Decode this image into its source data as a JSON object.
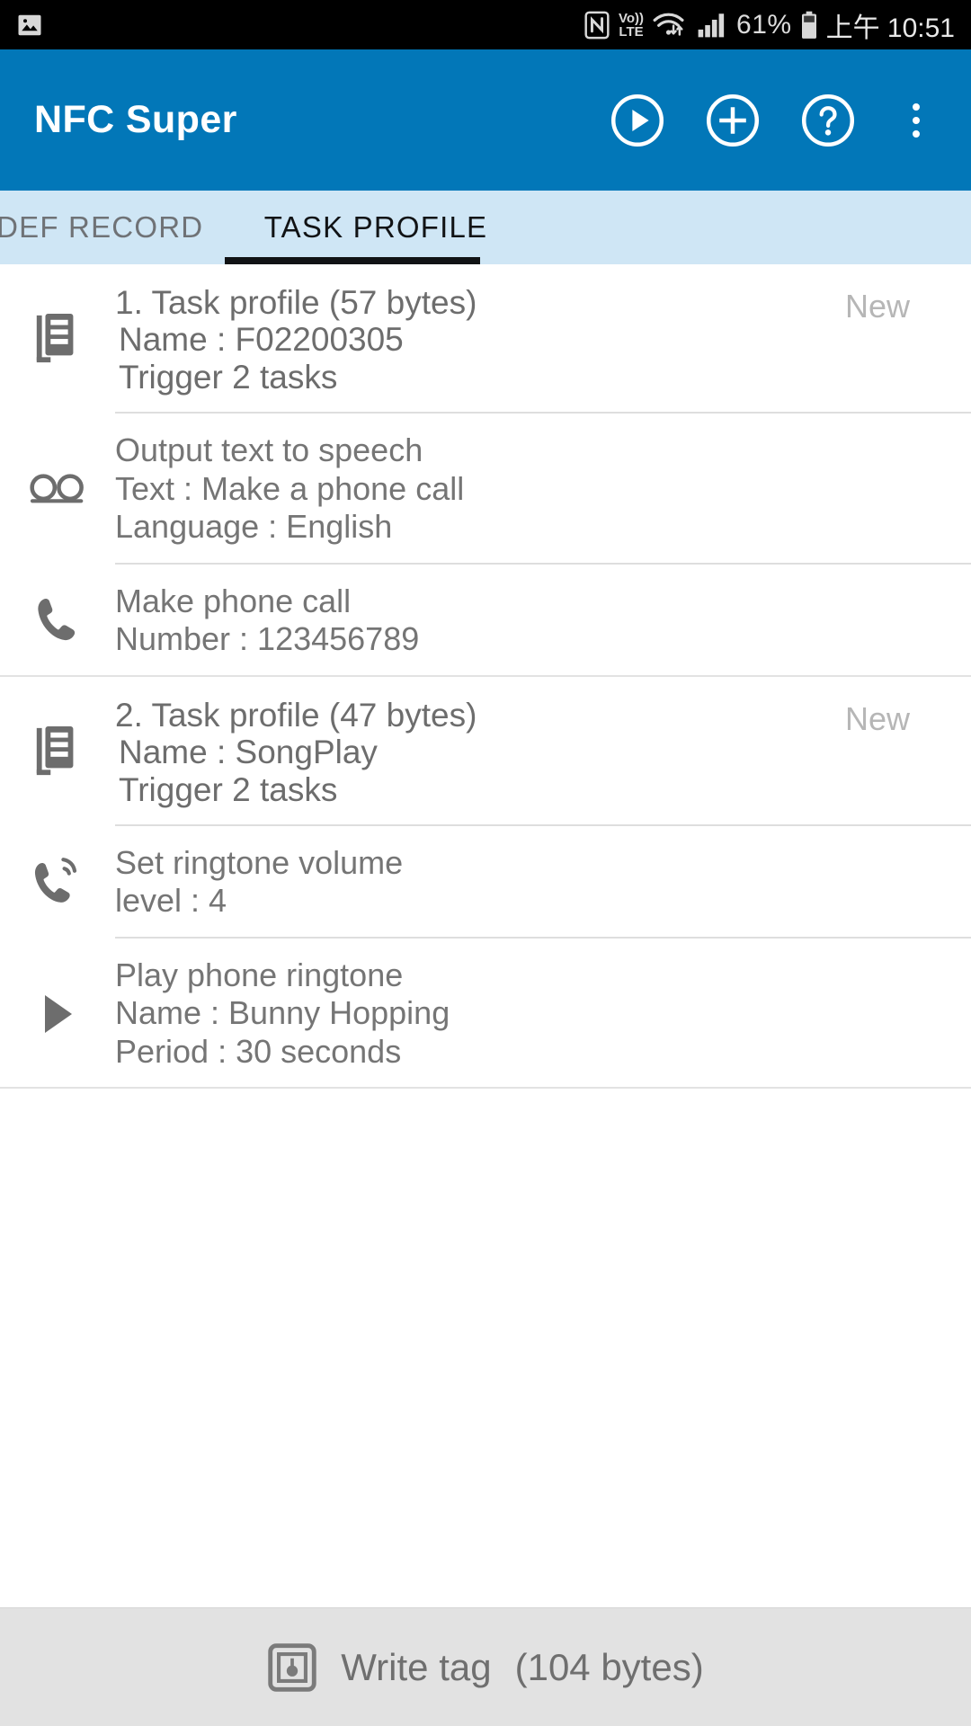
{
  "status_bar": {
    "left_icons": [
      "image-icon"
    ],
    "right_icons": [
      "nfc-icon",
      "volte-icon",
      "wifi-icon",
      "signal-icon",
      "battery-icon"
    ],
    "volte_top": "Vo))",
    "volte_bottom": "LTE",
    "battery_percent": "61%",
    "time": "上午 10:51"
  },
  "app_bar": {
    "title": "NFC Super",
    "actions": [
      {
        "name": "play-circle-icon",
        "label": "Run"
      },
      {
        "name": "plus-circle-icon",
        "label": "Add"
      },
      {
        "name": "help-circle-icon",
        "label": "Help"
      },
      {
        "name": "overflow-menu-icon",
        "label": "More options"
      }
    ]
  },
  "tabs": [
    {
      "label": "NDEF RECORD",
      "display": "IDEF RECORD",
      "active": false
    },
    {
      "label": "TASK PROFILE",
      "display": "TASK PROFILE",
      "active": true
    }
  ],
  "profiles": [
    {
      "index": "1.",
      "title": "1. Task profile (57 bytes)",
      "name_line": "Name :  F02200305",
      "trigger_line": "Trigger 2 tasks",
      "badge": "New",
      "icon": "task-profile-icon",
      "tasks": [
        {
          "icon": "text-to-speech-icon",
          "lines": [
            "Output text to speech",
            "Text : Make a phone call",
            "Language : English"
          ]
        },
        {
          "icon": "phone-call-icon",
          "lines": [
            "Make phone call",
            "Number : 123456789"
          ]
        }
      ]
    },
    {
      "index": "2.",
      "title": "2. Task profile (47 bytes)",
      "name_line": "Name :  SongPlay",
      "trigger_line": "Trigger 2 tasks",
      "badge": "New",
      "icon": "task-profile-icon",
      "tasks": [
        {
          "icon": "ringtone-volume-icon",
          "lines": [
            "Set ringtone volume",
            "level : 4"
          ]
        },
        {
          "icon": "play-ringtone-icon",
          "lines": [
            "Play phone ringtone",
            "Name : Bunny Hopping",
            "Period : 30 seconds"
          ]
        }
      ]
    }
  ],
  "bottom_bar": {
    "icon": "nfc-tag-icon",
    "label": "Write tag",
    "bytes": "(104 bytes)"
  },
  "colors": {
    "app_bar": "#0277b8",
    "tab_bar": "#cfe6f5",
    "tab_active_text": "#111315",
    "tab_inactive_text": "#6f7276",
    "body_text": "#757575",
    "badge_text": "#b6b6b6",
    "bottom_bar": "#e2e2e2",
    "status_bar": "#000000"
  }
}
